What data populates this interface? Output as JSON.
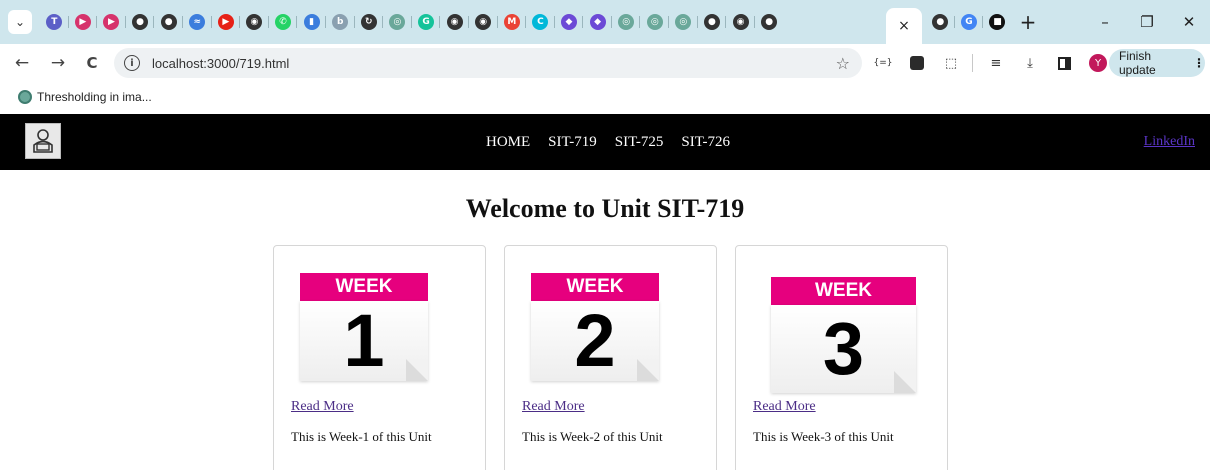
{
  "browser": {
    "tab_strip": {
      "icons": [
        {
          "name": "teams-icon",
          "color": "#5b5fc7",
          "glyph": "T"
        },
        {
          "name": "play-icon",
          "color": "#d6336c",
          "glyph": "▶"
        },
        {
          "name": "play-icon",
          "color": "#d6336c",
          "glyph": "▶"
        },
        {
          "name": "github-icon",
          "color": "#333333",
          "glyph": "●"
        },
        {
          "name": "github-icon",
          "color": "#333333",
          "glyph": "●"
        },
        {
          "name": "wave-icon",
          "color": "#3b7ddd",
          "glyph": "≈"
        },
        {
          "name": "youtube-icon",
          "color": "#e62117",
          "glyph": "▶"
        },
        {
          "name": "clock-icon",
          "color": "#333333",
          "glyph": "◉"
        },
        {
          "name": "whatsapp-icon",
          "color": "#25d366",
          "glyph": "✆"
        },
        {
          "name": "bookmark-icon",
          "color": "#3b7ddd",
          "glyph": "▮"
        },
        {
          "name": "bing-icon",
          "color": "#8aa0b0",
          "glyph": "b"
        },
        {
          "name": "refresh-icon",
          "color": "#333333",
          "glyph": "↻"
        },
        {
          "name": "chatgpt-icon",
          "color": "#6aa89a",
          "glyph": "◎"
        },
        {
          "name": "grammarly-icon",
          "color": "#15c39a",
          "glyph": "G"
        },
        {
          "name": "clock-icon",
          "color": "#333333",
          "glyph": "◉"
        },
        {
          "name": "clock-icon",
          "color": "#333333",
          "glyph": "◉"
        },
        {
          "name": "gmail-icon",
          "color": "#ea4335",
          "glyph": "M"
        },
        {
          "name": "canva-icon",
          "color": "#00b8d9",
          "glyph": "C"
        },
        {
          "name": "badge-icon",
          "color": "#6c4ad6",
          "glyph": "◆"
        },
        {
          "name": "badge-icon",
          "color": "#6c4ad6",
          "glyph": "◆"
        },
        {
          "name": "chatgpt-icon",
          "color": "#6aa89a",
          "glyph": "◎"
        },
        {
          "name": "chatgpt-icon",
          "color": "#6aa89a",
          "glyph": "◎"
        },
        {
          "name": "chatgpt-icon",
          "color": "#6aa89a",
          "glyph": "◎"
        },
        {
          "name": "github-icon",
          "color": "#333333",
          "glyph": "●"
        },
        {
          "name": "clock-icon",
          "color": "#333333",
          "glyph": "◉"
        },
        {
          "name": "github-icon",
          "color": "#333333",
          "glyph": "●"
        }
      ],
      "active_tab_close": "×",
      "after_icons": [
        {
          "name": "github-icon",
          "color": "#333333",
          "glyph": "●"
        },
        {
          "name": "google-icon",
          "color": "#4285f4",
          "glyph": "G"
        },
        {
          "name": "tsx-icon",
          "color": "#111111",
          "glyph": "■"
        }
      ],
      "new_tab": "+",
      "window_controls": {
        "minimize": "–",
        "restore": "❐",
        "close": "✕"
      }
    },
    "toolbar": {
      "back": "←",
      "forward": "→",
      "reload": "C",
      "url": "localhost:3000/719.html",
      "star": "☆",
      "finish_update": "Finish update",
      "menu_dots": "⋮",
      "profile_initial": "Y"
    },
    "bookmarks": [
      {
        "label": "Thresholding in ima..."
      }
    ]
  },
  "site": {
    "nav": {
      "links": [
        "HOME",
        "SIT-719",
        "SIT-725",
        "SIT-726"
      ],
      "linkedin": "LinkedIn"
    },
    "title": "Welcome to Unit SIT-719",
    "cards": [
      {
        "week_label": "WEEK",
        "week_number": "1",
        "link": "Read More",
        "description": "This is Week-1 of this Unit"
      },
      {
        "week_label": "WEEK",
        "week_number": "2",
        "link": "Read More",
        "description": "This is Week-2 of this Unit"
      },
      {
        "week_label": "WEEK",
        "week_number": "3",
        "link": "Read More",
        "description": "This is Week-3 of this Unit"
      }
    ],
    "colors": {
      "nav_bg": "#000000",
      "calendar_accent": "#e6007e",
      "link": "#4b2d86"
    }
  }
}
